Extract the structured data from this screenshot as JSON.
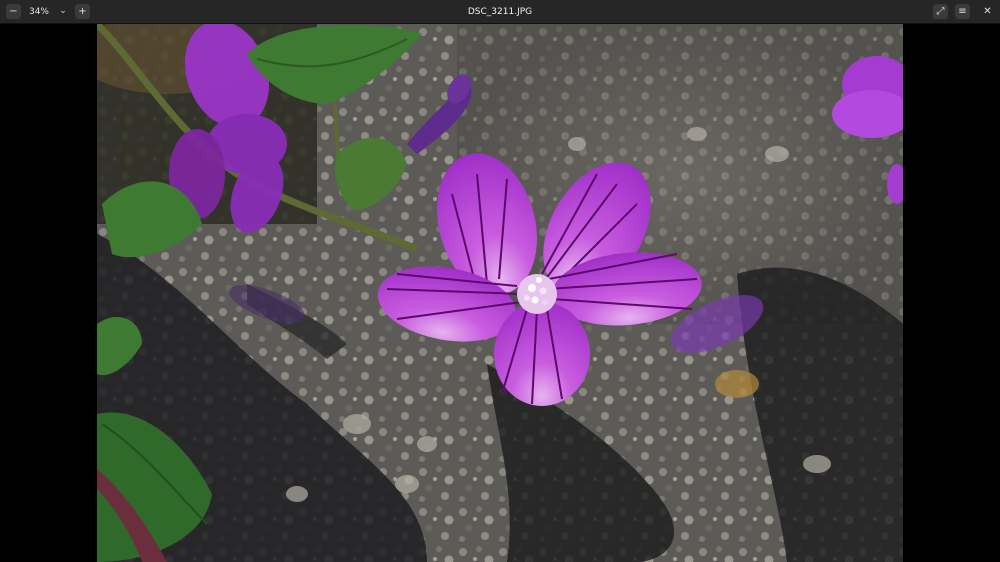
{
  "toolbar": {
    "zoom_out_icon": "zoom-out-icon",
    "zoom_level": "34%",
    "zoom_menu_icon": "chevron-down-icon",
    "zoom_in_icon": "zoom-in-icon",
    "title": "DSC_3211.JPG",
    "fullscreen_icon": "fullscreen-icon",
    "menu_icon": "hamburger-menu-icon",
    "close_icon": "close-icon"
  },
  "photo": {
    "subject": "Purple mallow flower over gravel",
    "colors": {
      "petal": "#b13fd6",
      "petal_vein": "#5c0a6b",
      "leaf": "#3e7a32",
      "gravel": "#6e6b66",
      "shadow": "#1b1b1e"
    }
  }
}
